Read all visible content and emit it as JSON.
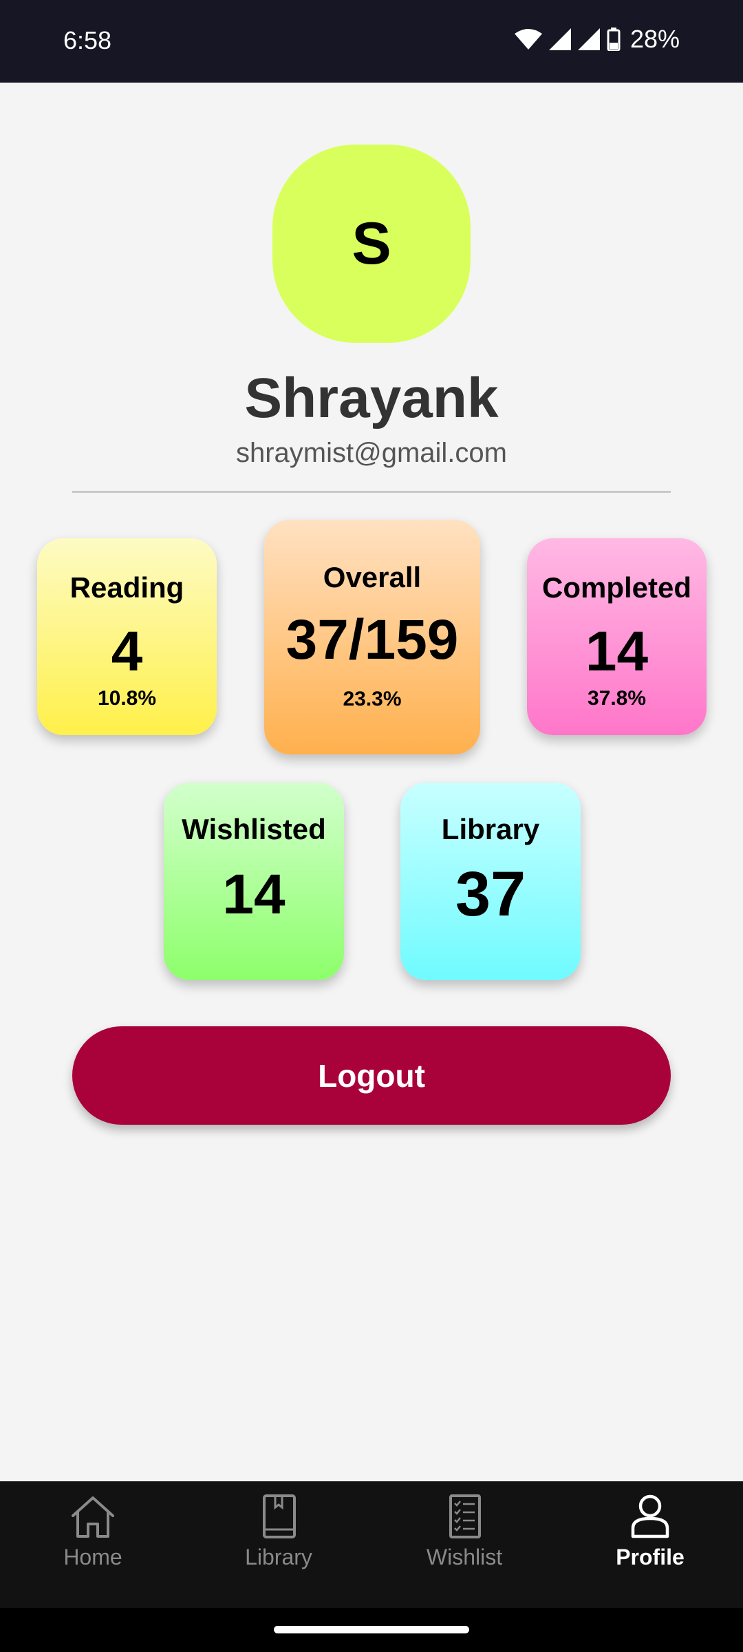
{
  "status_bar": {
    "time": "6:58",
    "battery": "28%",
    "icons": [
      "wifi-icon",
      "signal-icon",
      "signal-icon",
      "battery-icon"
    ]
  },
  "profile": {
    "avatar_letter": "S",
    "name": "Shrayank",
    "email": "shraymist@gmail.com"
  },
  "stats": {
    "reading": {
      "label": "Reading",
      "value": "4",
      "percent": "10.8%",
      "colors": [
        "#fdfbc4",
        "#fff04a"
      ]
    },
    "overall": {
      "label": "Overall",
      "value": "37/159",
      "percent": "23.3%",
      "colors": [
        "#ffe1c2",
        "#ffb04d"
      ]
    },
    "completed": {
      "label": "Completed",
      "value": "14",
      "percent": "37.8%",
      "colors": [
        "#ffb9e4",
        "#ff76c9"
      ]
    },
    "wishlisted": {
      "label": "Wishlisted",
      "value": "14",
      "colors": [
        "#d2ffcc",
        "#8dff6b"
      ]
    },
    "library": {
      "label": "Library",
      "value": "37",
      "colors": [
        "#c8ffff",
        "#6ffbff"
      ]
    }
  },
  "logout": {
    "label": "Logout",
    "color": "#a9023a"
  },
  "bottom_nav": {
    "items": [
      {
        "label": "Home",
        "icon": "home-icon",
        "active": false
      },
      {
        "label": "Library",
        "icon": "book-icon",
        "active": false
      },
      {
        "label": "Wishlist",
        "icon": "checklist-icon",
        "active": false
      },
      {
        "label": "Profile",
        "icon": "person-icon",
        "active": true
      }
    ]
  },
  "colors": {
    "avatar": "#d9ff5c",
    "status_bar": "#161624",
    "nav_background": "#121212"
  }
}
